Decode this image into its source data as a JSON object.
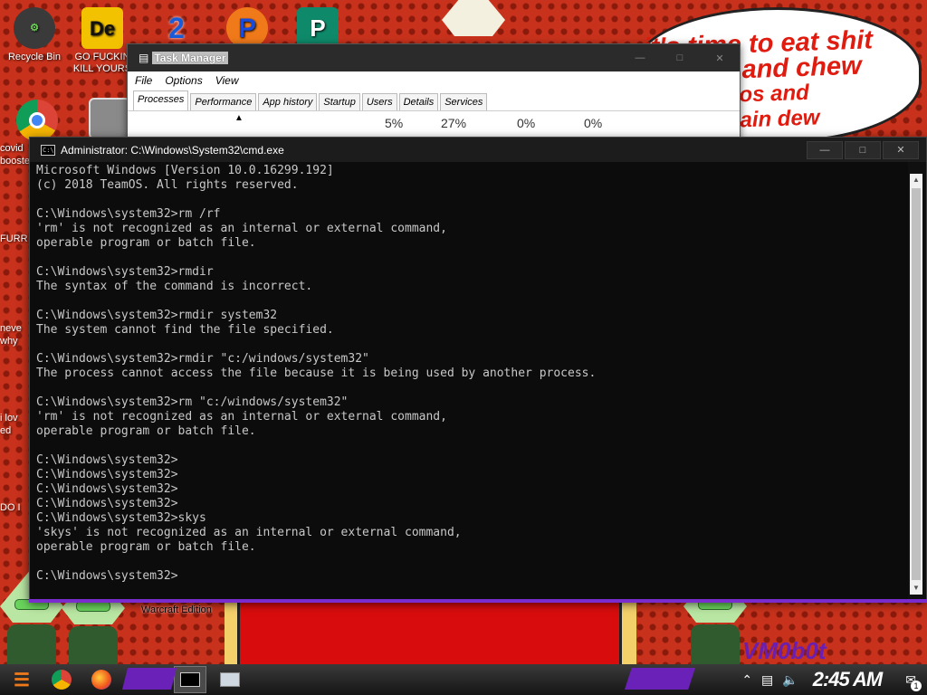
{
  "desktop": {
    "icons": [
      {
        "label": "Recycle Bin",
        "glyph": "⚙"
      },
      {
        "label": "GO FUCKIN KILL YOURS",
        "glyph": "De"
      },
      {
        "label": "",
        "glyph": "2"
      },
      {
        "label": "",
        "glyph": "P"
      },
      {
        "label": "",
        "glyph": "P"
      }
    ],
    "side_fragments": [
      "covid",
      "booste",
      "FURR",
      "neve",
      "why",
      "i lov",
      "ed",
      "DO I"
    ],
    "bubble": {
      "line1": "it's time to eat shit",
      "line2": "and chew",
      "line3": "os and",
      "line4": "ain dew"
    },
    "wallpaper_label": "Warcraft Edition",
    "corner_tag": "VM0b0t"
  },
  "task_manager": {
    "title": "Task Manager",
    "menu": [
      "File",
      "Options",
      "View"
    ],
    "tabs": [
      "Processes",
      "Performance",
      "App history",
      "Startup",
      "Users",
      "Details",
      "Services"
    ],
    "active_tab": "Processes",
    "stats": [
      "5%",
      "27%",
      "0%",
      "0%"
    ]
  },
  "cmd": {
    "title": "Administrator: C:\\Windows\\System32\\cmd.exe",
    "icon": "C:\\",
    "lines": [
      "Microsoft Windows [Version 10.0.16299.192]",
      "(c) 2018 TeamOS. All rights reserved.",
      "",
      "C:\\Windows\\system32>rm /rf",
      "'rm' is not recognized as an internal or external command,",
      "operable program or batch file.",
      "",
      "C:\\Windows\\system32>rmdir",
      "The syntax of the command is incorrect.",
      "",
      "C:\\Windows\\system32>rmdir system32",
      "The system cannot find the file specified.",
      "",
      "C:\\Windows\\system32>rmdir \"c:/windows/system32\"",
      "The process cannot access the file because it is being used by another process.",
      "",
      "C:\\Windows\\system32>rm \"c:/windows/system32\"",
      "'rm' is not recognized as an internal or external command,",
      "operable program or batch file.",
      "",
      "C:\\Windows\\system32>",
      "C:\\Windows\\system32>",
      "C:\\Windows\\system32>",
      "C:\\Windows\\system32>",
      "C:\\Windows\\system32>skys",
      "'skys' is not recognized as an internal or external command,",
      "operable program or batch file.",
      "",
      "C:\\Windows\\system32>"
    ]
  },
  "taskbar": {
    "clock": "2:45 AM",
    "notification_count": "1"
  }
}
